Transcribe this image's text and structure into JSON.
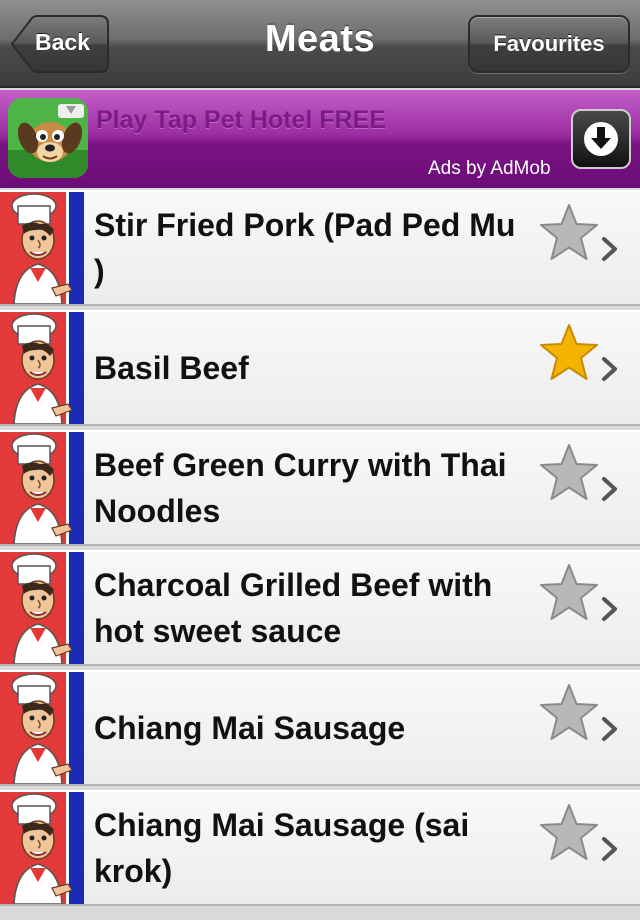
{
  "navbar": {
    "title": "Meats",
    "back_label": "Back",
    "favourites_label": "Favourites"
  },
  "ad": {
    "title": "Play Tap Pet Hotel FREE",
    "attribution": "Ads by AdMob"
  },
  "recipes": [
    {
      "title": "Stir Fried Pork (Pad Ped Mu )",
      "favourite": false
    },
    {
      "title": "Basil Beef",
      "favourite": true
    },
    {
      "title": "Beef Green Curry with Thai Noodles",
      "favourite": false
    },
    {
      "title": "Charcoal Grilled Beef with hot sweet sauce",
      "favourite": false
    },
    {
      "title": "Chiang Mai Sausage",
      "favourite": false
    },
    {
      "title": "Chiang Mai Sausage (sai krok)",
      "favourite": false
    }
  ],
  "colors": {
    "star_active": "#f5b400",
    "star_inactive": "#b8b8b8",
    "ad_purple": "#8b1f94"
  }
}
